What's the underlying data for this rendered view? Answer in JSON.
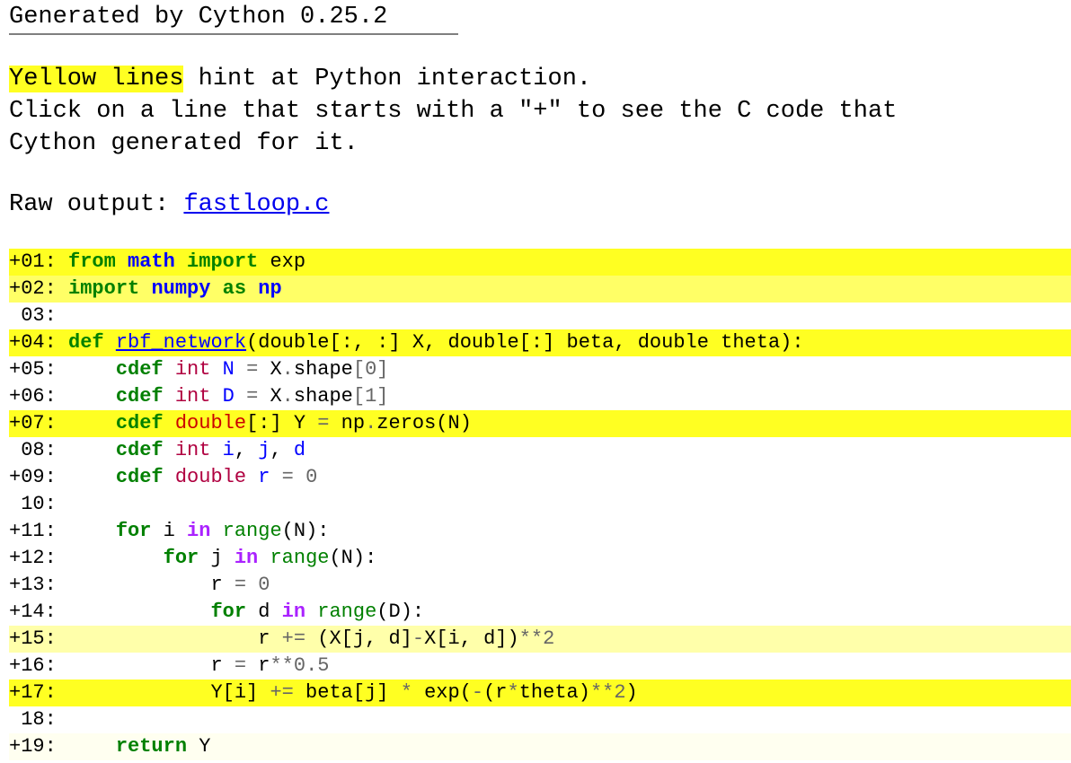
{
  "header": {
    "title": "Generated by Cython 0.25.2"
  },
  "intro": {
    "highlight": "Yellow lines",
    "rest_line1": " hint at Python interaction.",
    "line2": "Click on a line that starts with a \"+\" to see the C code that",
    "line3": "Cython generated for it."
  },
  "raw_output": {
    "label": "Raw output: ",
    "link_text": "fastloop.c"
  },
  "colors": {
    "highlight_strong": "#ffff22",
    "highlight_medium": "#ffff66",
    "highlight_light": "#ffffaa",
    "highlight_faint": "#fffff0",
    "link": "#0000ee",
    "keyword": "#008000",
    "builtin": "#0000ff",
    "type": "#b00040"
  },
  "code": {
    "lines": [
      {
        "prefix": "+01:",
        "text": " from math import exp"
      },
      {
        "prefix": "+02:",
        "text": " import numpy as np"
      },
      {
        "prefix": " 03:",
        "text": ""
      },
      {
        "prefix": "+04:",
        "text": " def rbf_network(double[:, :] X, double[:] beta, double theta):"
      },
      {
        "prefix": "+05:",
        "text": "     cdef int N = X.shape[0]"
      },
      {
        "prefix": "+06:",
        "text": "     cdef int D = X.shape[1]"
      },
      {
        "prefix": "+07:",
        "text": "     cdef double[:] Y = np.zeros(N)"
      },
      {
        "prefix": " 08:",
        "text": "     cdef int i, j, d"
      },
      {
        "prefix": "+09:",
        "text": "     cdef double r = 0"
      },
      {
        "prefix": " 10:",
        "text": ""
      },
      {
        "prefix": "+11:",
        "text": "     for i in range(N):"
      },
      {
        "prefix": "+12:",
        "text": "         for j in range(N):"
      },
      {
        "prefix": "+13:",
        "text": "             r = 0"
      },
      {
        "prefix": "+14:",
        "text": "             for d in range(D):"
      },
      {
        "prefix": "+15:",
        "text": "                 r += (X[j, d]-X[i, d])**2"
      },
      {
        "prefix": "+16:",
        "text": "             r = r**0.5"
      },
      {
        "prefix": "+17:",
        "text": "             Y[i] += beta[j] * exp(-(r*theta)**2)"
      },
      {
        "prefix": " 18:",
        "text": ""
      },
      {
        "prefix": "+19:",
        "text": "     return Y"
      }
    ]
  }
}
